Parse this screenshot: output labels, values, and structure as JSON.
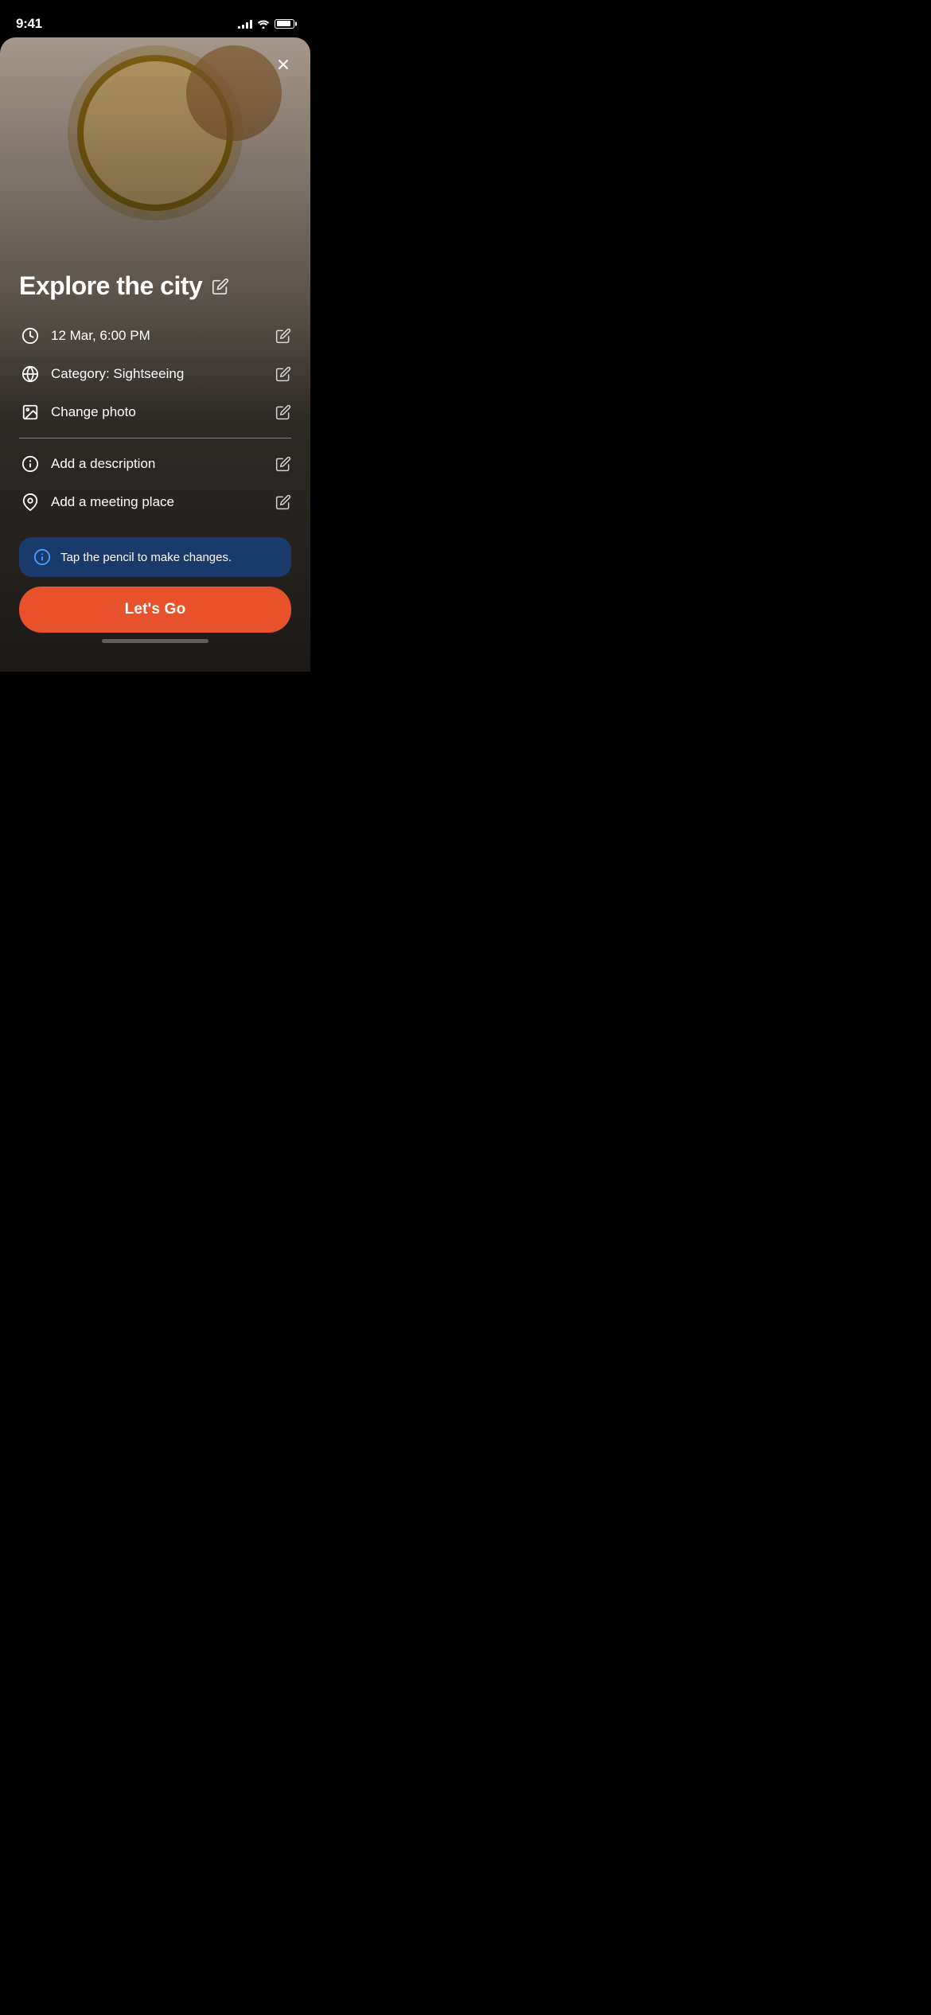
{
  "statusBar": {
    "time": "9:41",
    "signalBars": [
      3,
      5,
      7,
      9,
      11
    ],
    "battery": 85
  },
  "card": {
    "closeIcon": "x-icon",
    "title": "Explore the city",
    "titleEditIcon": "pencil-icon",
    "details": [
      {
        "id": "datetime",
        "icon": "clock-icon",
        "text": "12 Mar, 6:00 PM",
        "editIcon": "pencil-icon"
      },
      {
        "id": "category",
        "icon": "globe-icon",
        "text": "Category: Sightseeing",
        "editIcon": "pencil-icon"
      },
      {
        "id": "photo",
        "icon": "image-icon",
        "text": "Change photo",
        "editIcon": "pencil-icon"
      }
    ],
    "optionalDetails": [
      {
        "id": "description",
        "icon": "info-icon",
        "text": "Add a description",
        "editIcon": "pencil-icon"
      },
      {
        "id": "meeting-place",
        "icon": "location-icon",
        "text": "Add a meeting place",
        "editIcon": "pencil-icon"
      }
    ],
    "infoBanner": {
      "icon": "info-circle-icon",
      "text": "Tap the pencil to make changes."
    },
    "primaryButton": {
      "label": "Let's Go"
    }
  }
}
